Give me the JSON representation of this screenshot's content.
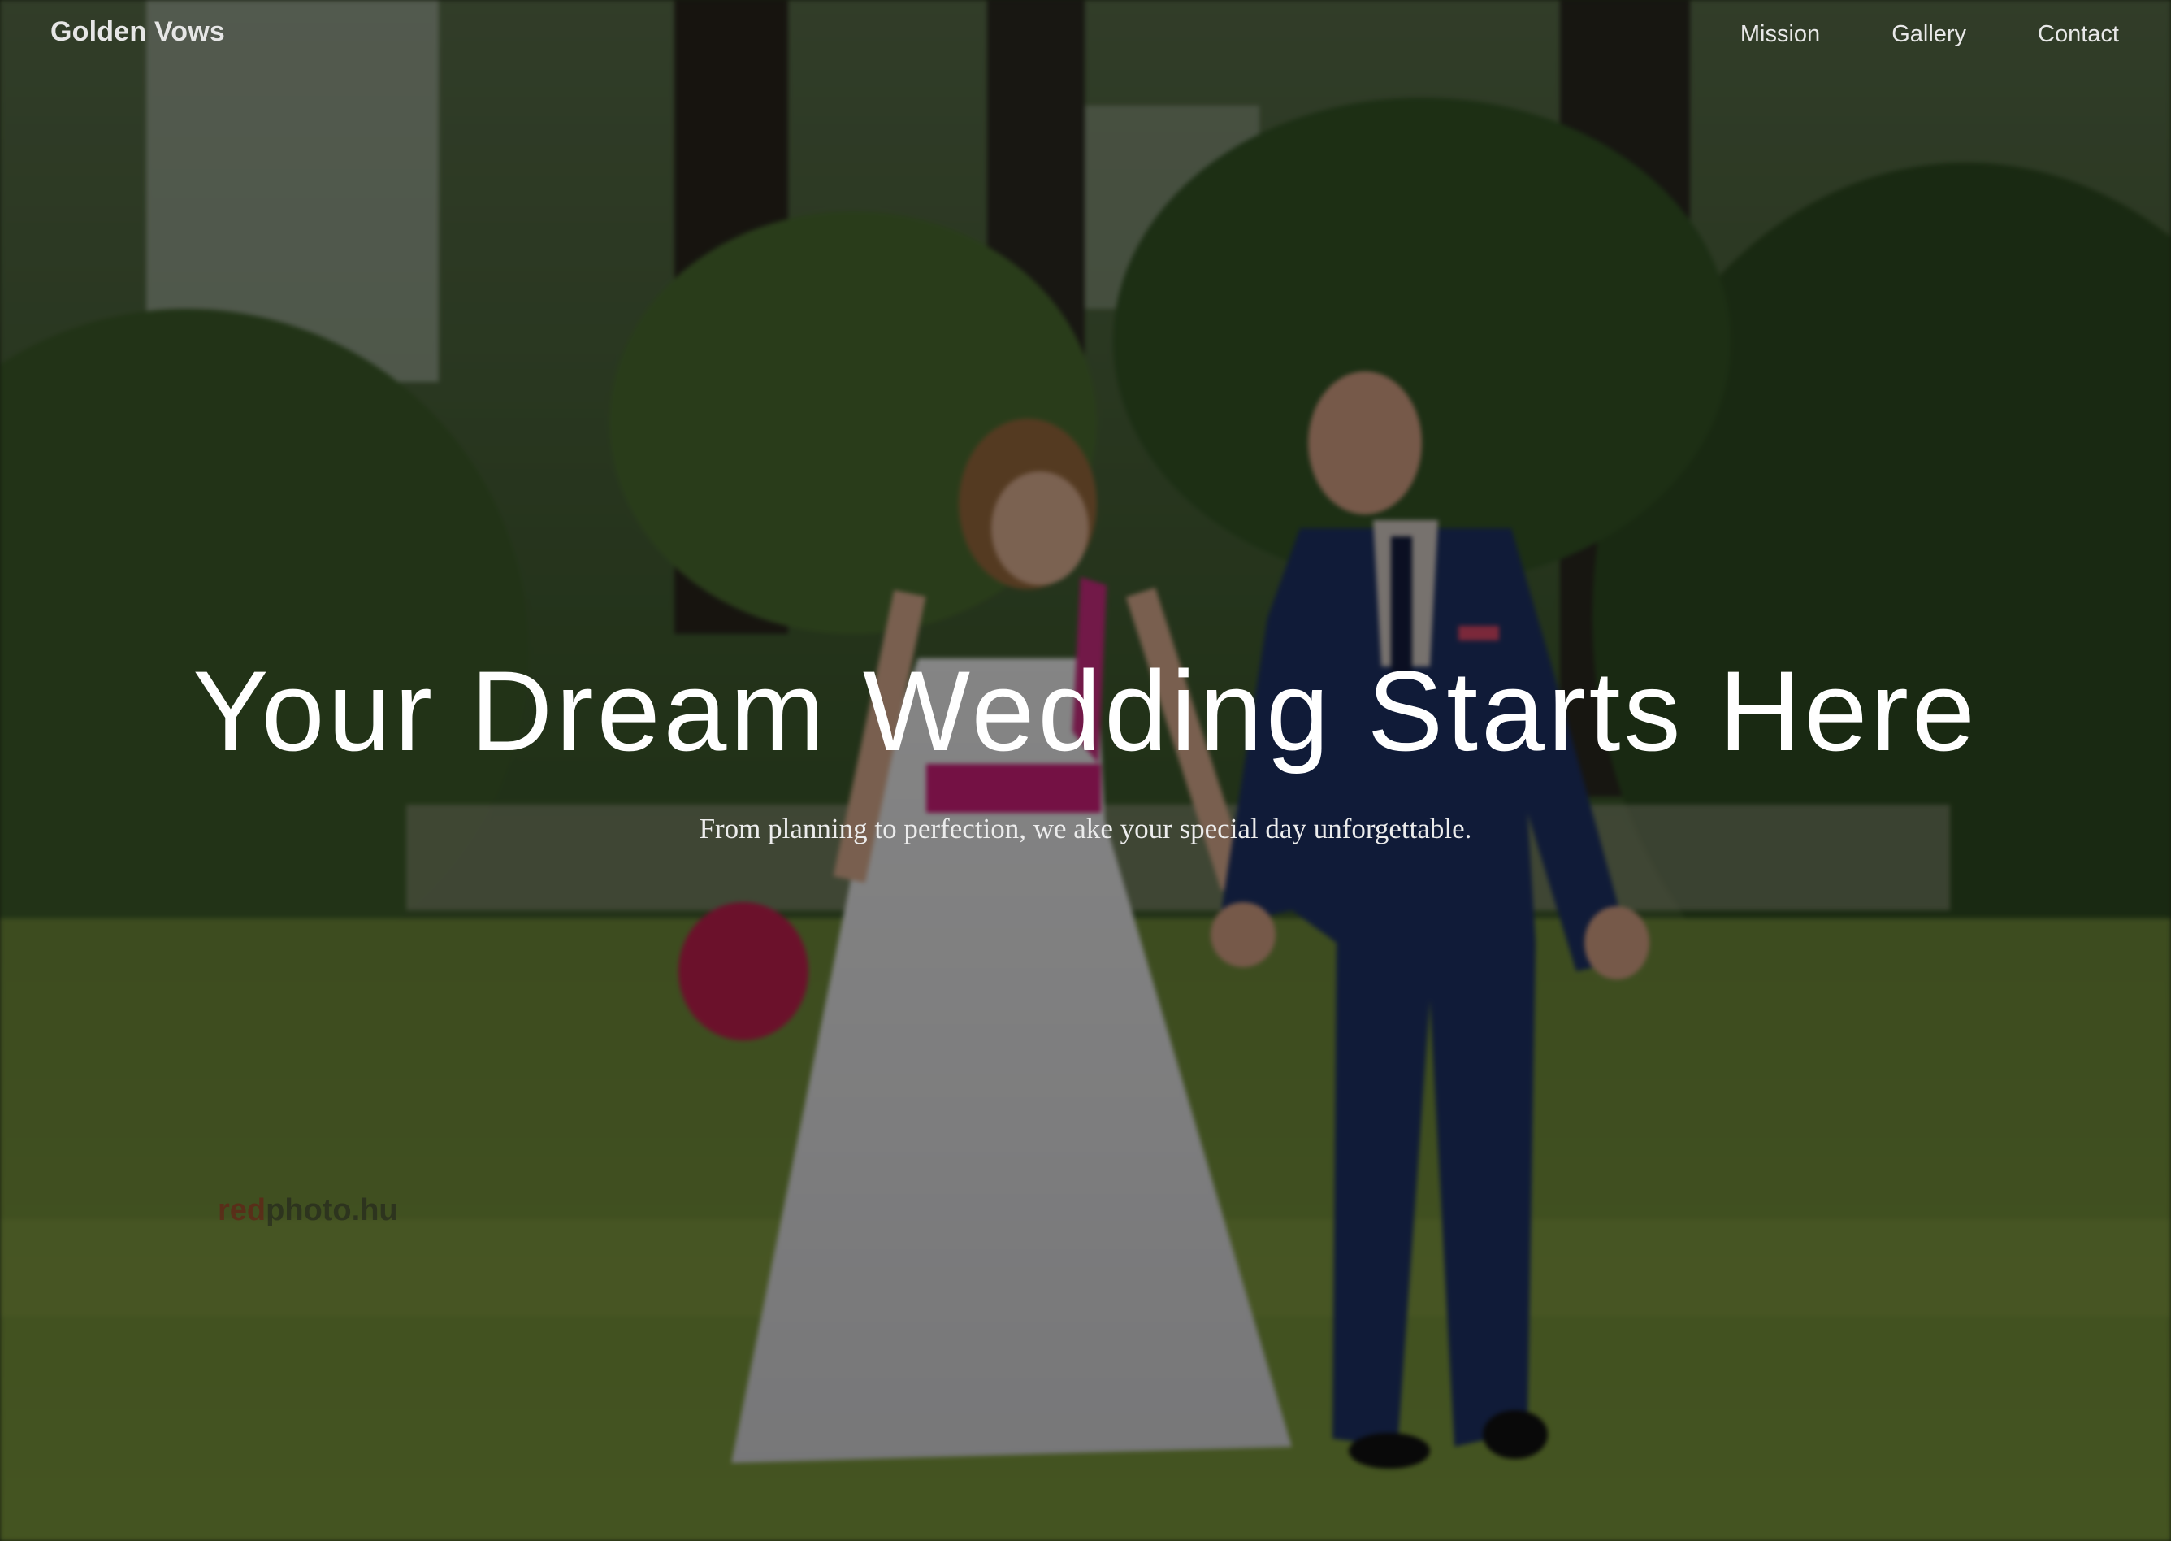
{
  "brand": {
    "name": "Golden Vows"
  },
  "nav": {
    "links": [
      {
        "label": "Mission"
      },
      {
        "label": "Gallery"
      },
      {
        "label": "Contact"
      }
    ]
  },
  "hero": {
    "headline": "Your Dream Wedding Starts Here",
    "subheadline": "From planning to perfection, we ake your special day unforgettable.",
    "background": "Bride and groom walking hand in hand in a green park",
    "watermark": {
      "prefix": "red",
      "rest": "photo.hu"
    }
  },
  "colors": {
    "overlay": "#000000",
    "text": "#ffffff",
    "grass": "#5f7a2e",
    "foliage": "#2f4a22",
    "dress_accent": "#d31f7c",
    "suit": "#1e3266"
  }
}
